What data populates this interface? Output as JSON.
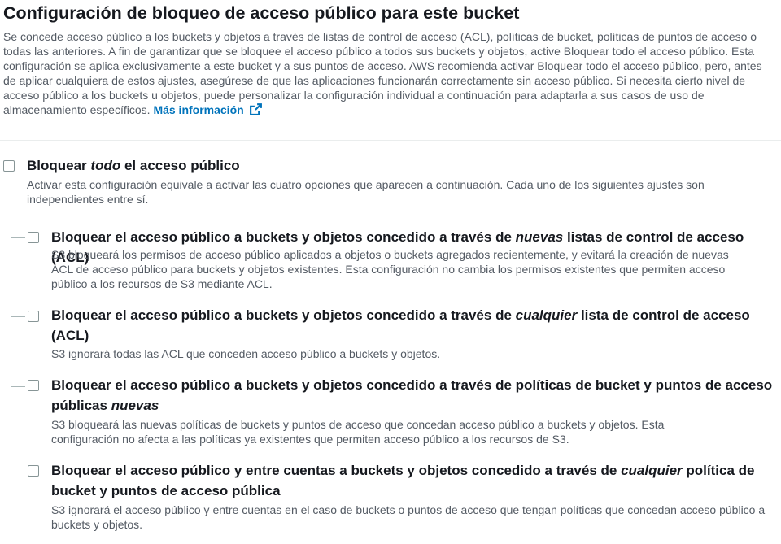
{
  "section": {
    "title": "Configuración de bloqueo de acceso público para este bucket",
    "description": "Se concede acceso público a los buckets y objetos a través de listas de control de acceso (ACL), políticas de bucket, políticas de puntos de acceso o todas las anteriores. A fin de garantizar que se bloquee el acceso público a todos sus buckets y objetos, active Bloquear todo el acceso público. Esta configuración se aplica exclusivamente a este bucket y a sus puntos de acceso. AWS recomienda activar Bloquear todo el acceso público, pero, antes de aplicar cualquiera de estos ajustes, asegúrese de que las aplicaciones funcionarán correctamente sin acceso público. Si necesita cierto nivel de acceso público a los buckets u objetos, puede personalizar la configuración individual a continuación para adaptarla a sus casos de uso de almacenamiento específicos.",
    "link_label": "Más información",
    "link_icon": "external-link-icon",
    "accent_color": "#0073bb"
  },
  "block_all": {
    "checked": false,
    "label_pre": "Bloquear ",
    "label_em": "todo",
    "label_post": " el acceso público",
    "description": "Activar esta configuración equivale a activar las cuatro opciones que aparecen a continuación. Cada uno de los siguientes ajustes son independientes entre sí."
  },
  "options": [
    {
      "checked": false,
      "label_pre": "Bloquear el acceso público a buckets y objetos concedido a través de ",
      "label_em": "nuevas",
      "label_post": " listas de control de acceso (ACL)",
      "description": "S3 bloqueará los permisos de acceso público aplicados a objetos o buckets agregados recientemente, y evitará la creación de nuevas ACL de acceso público para buckets y objetos existentes. Esta configuración no cambia los permisos existentes que permiten acceso público a los recursos de S3 mediante ACL."
    },
    {
      "checked": false,
      "label_pre": "Bloquear el acceso público a buckets y objetos concedido a través de ",
      "label_em": "cualquier",
      "label_post": " lista de control de acceso (ACL)",
      "description": "S3 ignorará todas las ACL que conceden acceso público a buckets y objetos."
    },
    {
      "checked": false,
      "label_pre": "Bloquear el acceso público a buckets y objetos concedido a través de políticas de bucket y puntos de acceso públicas ",
      "label_em": "nuevas",
      "label_post": "",
      "description": "S3 bloqueará las nuevas políticas de buckets y puntos de acceso que concedan acceso público a buckets y objetos. Esta configuración no afecta a las políticas ya existentes que permiten acceso público a los recursos de S3."
    },
    {
      "checked": false,
      "label_pre": "Bloquear el acceso público y entre cuentas a buckets y objetos concedido a través de ",
      "label_em": "cualquier",
      "label_post": " política de bucket y puntos de acceso pública",
      "description": "S3 ignorará el acceso público y entre cuentas en el caso de buckets o puntos de acceso que tengan políticas que concedan acceso público a buckets y objetos."
    }
  ]
}
